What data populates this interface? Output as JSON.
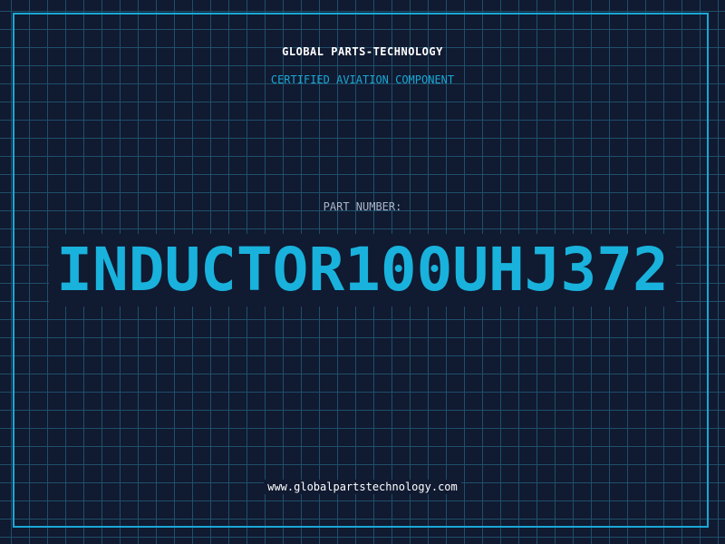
{
  "header": {
    "company_name": "GLOBAL PARTS-TECHNOLOGY",
    "tagline": "CERTIFIED AVIATION COMPONENT"
  },
  "part": {
    "label": "PART NUMBER:",
    "number": "INDUCTOR100UHJ372"
  },
  "footer": {
    "website": "www.globalpartstechnology.com"
  },
  "colors": {
    "background": "#101a31",
    "grid": "#1f4f6a",
    "accent": "#1aa7d4",
    "text": "#ffffff",
    "muted": "#a9b6c8"
  }
}
